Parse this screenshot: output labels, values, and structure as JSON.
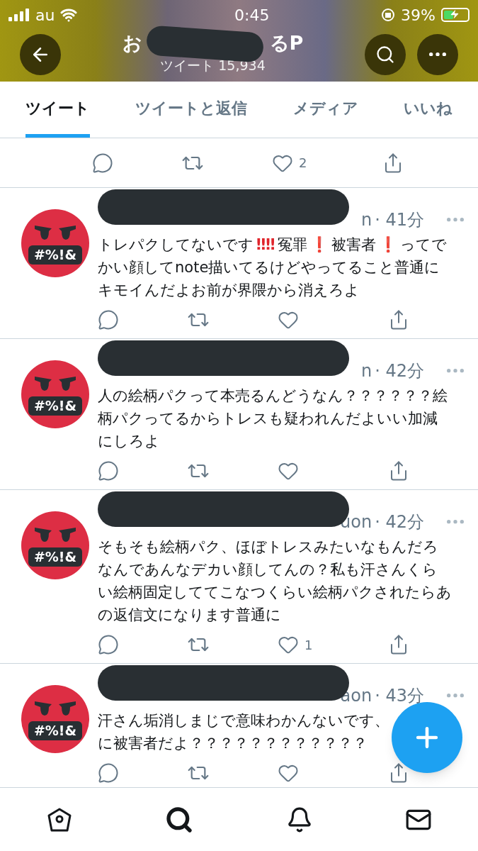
{
  "status_bar": {
    "carrier": "au",
    "time": "0:45",
    "battery": "39%"
  },
  "header": {
    "title_start": "お",
    "title_end": "るP",
    "subtitle": "ツイート 15,934"
  },
  "tabs": [
    {
      "label": "ツイート",
      "selected": true
    },
    {
      "label": "ツイートと返信",
      "selected": false
    },
    {
      "label": "メディア",
      "selected": false
    },
    {
      "label": "いいね",
      "selected": false
    }
  ],
  "partial_actions": {
    "like_count": "2"
  },
  "tweets": [
    {
      "avatar_symbols": "#%!&",
      "handle_fragment": "n",
      "time": "· 41分",
      "text": [
        {
          "kind": "plain",
          "text": "トレパクしてないです"
        },
        {
          "kind": "emoji",
          "text": "‼‼"
        },
        {
          "kind": "plain",
          "text": "冤罪"
        },
        {
          "kind": "emoji",
          "text": "❗"
        },
        {
          "kind": "plain",
          "text": "被害者"
        },
        {
          "kind": "emoji",
          "text": "❗"
        },
        {
          "kind": "plain",
          "text": "ってでかい顔してnote描いてるけどやってること普通にキモイんだよお前が界隈から消えろよ"
        }
      ]
    },
    {
      "avatar_symbols": "#%!&",
      "handle_fragment": "n",
      "time": "· 42分",
      "text": [
        {
          "kind": "plain",
          "text": "人の絵柄パクって本売るんどうなん？？？？？？絵柄パクってるからトレスも疑われんだよいい加減にしろよ"
        }
      ]
    },
    {
      "avatar_symbols": "#%!&",
      "handle_fragment": "uon",
      "time": "· 42分",
      "text": [
        {
          "kind": "plain",
          "text": "そもそも絵柄パク、ほぼトレスみたいなもんだろなんであんなデカい顔してんの？私も汗さんくらい絵柄固定しててこなつくらい絵柄パクされたらあの返信文になります普通に"
        }
      ],
      "like_count": "1"
    },
    {
      "avatar_symbols": "#%!&",
      "handle_fragment": "aon",
      "time": "· 43分",
      "text": [
        {
          "kind": "line",
          "text": "汗さん垢消しまじで意味わかんないです、"
        },
        {
          "kind": "line",
          "text": "に被害者だよ？？？？？？？？？？？？"
        }
      ]
    }
  ]
}
